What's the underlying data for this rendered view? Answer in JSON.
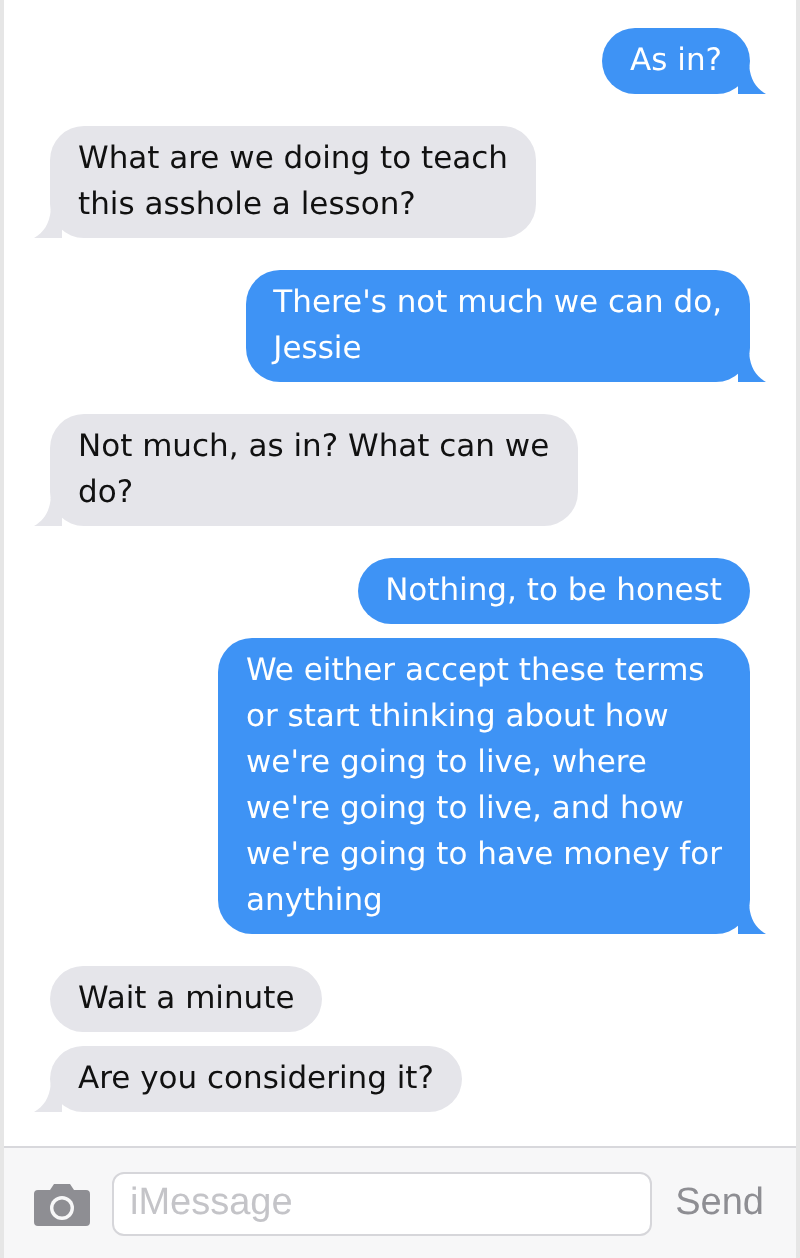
{
  "messages": [
    {
      "kind": "sent",
      "text": "As in?",
      "tail": true
    },
    {
      "kind": "received",
      "text": "What are we doing to teach\nthis asshole a lesson?",
      "tail": true
    },
    {
      "kind": "sent",
      "text": "There's not much we can do,\nJessie",
      "tail": true
    },
    {
      "kind": "received",
      "text": "Not much, as in? What can we\ndo?",
      "tail": true
    },
    {
      "kind": "sent",
      "text": "Nothing, to be honest",
      "tail": false
    },
    {
      "kind": "sent",
      "text": "We either accept these terms\nor start thinking about how\nwe're going to live, where\nwe're going to live, and how\nwe're going to have money for\nanything",
      "tail": true
    },
    {
      "kind": "received",
      "text": "Wait a minute",
      "tail": false
    },
    {
      "kind": "received",
      "text": "Are you considering it?",
      "tail": true
    }
  ],
  "composer": {
    "placeholder": "iMessage",
    "send_label": "Send"
  }
}
